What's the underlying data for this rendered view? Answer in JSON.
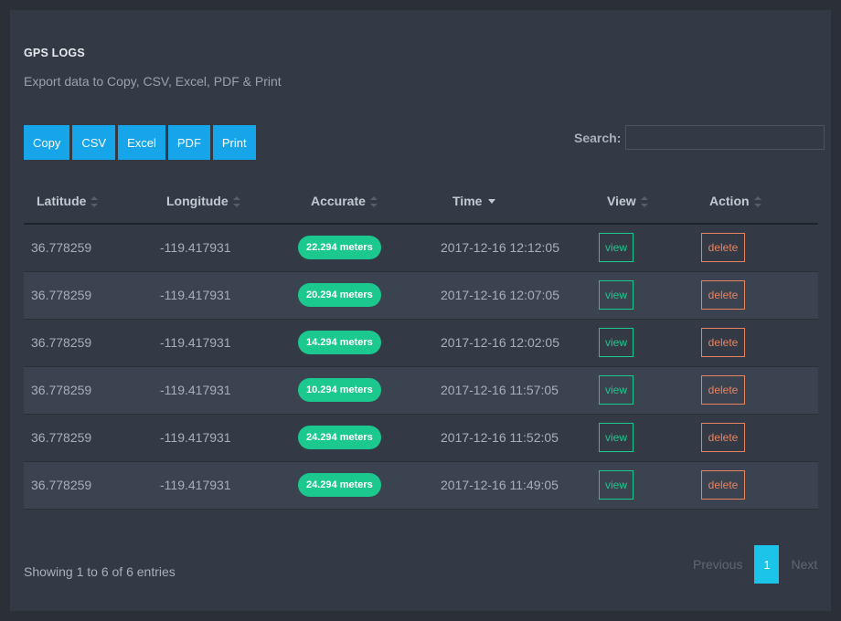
{
  "header": {
    "title": "GPS LOGS",
    "subtitle": "Export data to Copy, CSV, Excel, PDF & Print"
  },
  "export_buttons": [
    "Copy",
    "CSV",
    "Excel",
    "PDF",
    "Print"
  ],
  "search": {
    "label": "Search:",
    "value": ""
  },
  "table": {
    "columns": [
      "Latitude",
      "Longitude",
      "Accurate",
      "Time",
      "View",
      "Action"
    ],
    "sorted_column": "Time",
    "sort_direction": "desc",
    "rows": [
      {
        "latitude": "36.778259",
        "longitude": "-119.417931",
        "accurate": "22.294 meters",
        "time": "2017-12-16 12:12:05",
        "view": "view",
        "action": "delete"
      },
      {
        "latitude": "36.778259",
        "longitude": "-119.417931",
        "accurate": "20.294 meters",
        "time": "2017-12-16 12:07:05",
        "view": "view",
        "action": "delete"
      },
      {
        "latitude": "36.778259",
        "longitude": "-119.417931",
        "accurate": "14.294 meters",
        "time": "2017-12-16 12:02:05",
        "view": "view",
        "action": "delete"
      },
      {
        "latitude": "36.778259",
        "longitude": "-119.417931",
        "accurate": "10.294 meters",
        "time": "2017-12-16 11:57:05",
        "view": "view",
        "action": "delete"
      },
      {
        "latitude": "36.778259",
        "longitude": "-119.417931",
        "accurate": "24.294 meters",
        "time": "2017-12-16 11:52:05",
        "view": "view",
        "action": "delete"
      },
      {
        "latitude": "36.778259",
        "longitude": "-119.417931",
        "accurate": "24.294 meters",
        "time": "2017-12-16 11:49:05",
        "view": "view",
        "action": "delete"
      }
    ]
  },
  "footer": {
    "info": "Showing 1 to 6 of 6 entries",
    "pagination": {
      "previous": "Previous",
      "current": "1",
      "next": "Next"
    }
  },
  "colors": {
    "background": "#2a2f38",
    "card": "#343a45",
    "button_blue": "#15a5e8",
    "badge_green": "#1bc98e",
    "delete_orange": "#e8835f",
    "page_active": "#1dc4e9"
  }
}
